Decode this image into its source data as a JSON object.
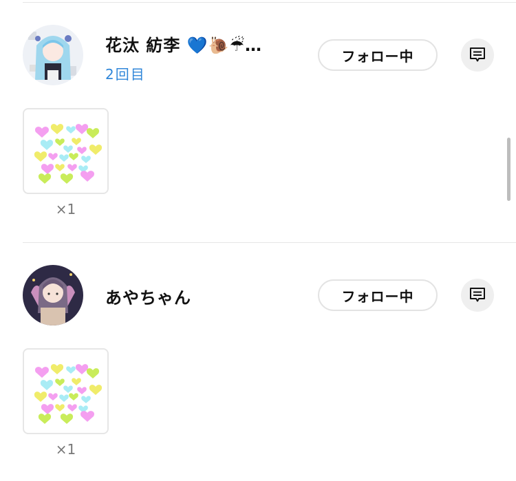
{
  "entries": [
    {
      "name": "花汰 紡李 💙🐌☔…",
      "visit": "2回目",
      "follow_label": "フォロー中",
      "gift_count": "×1"
    },
    {
      "name": "あやちゃん",
      "follow_label": "フォロー中",
      "gift_count": "×1"
    }
  ],
  "colors": {
    "link_blue": "#2f86d9",
    "divider": "#e6e6e6",
    "button_border": "#e3e3e3",
    "message_bg": "#efefef"
  }
}
